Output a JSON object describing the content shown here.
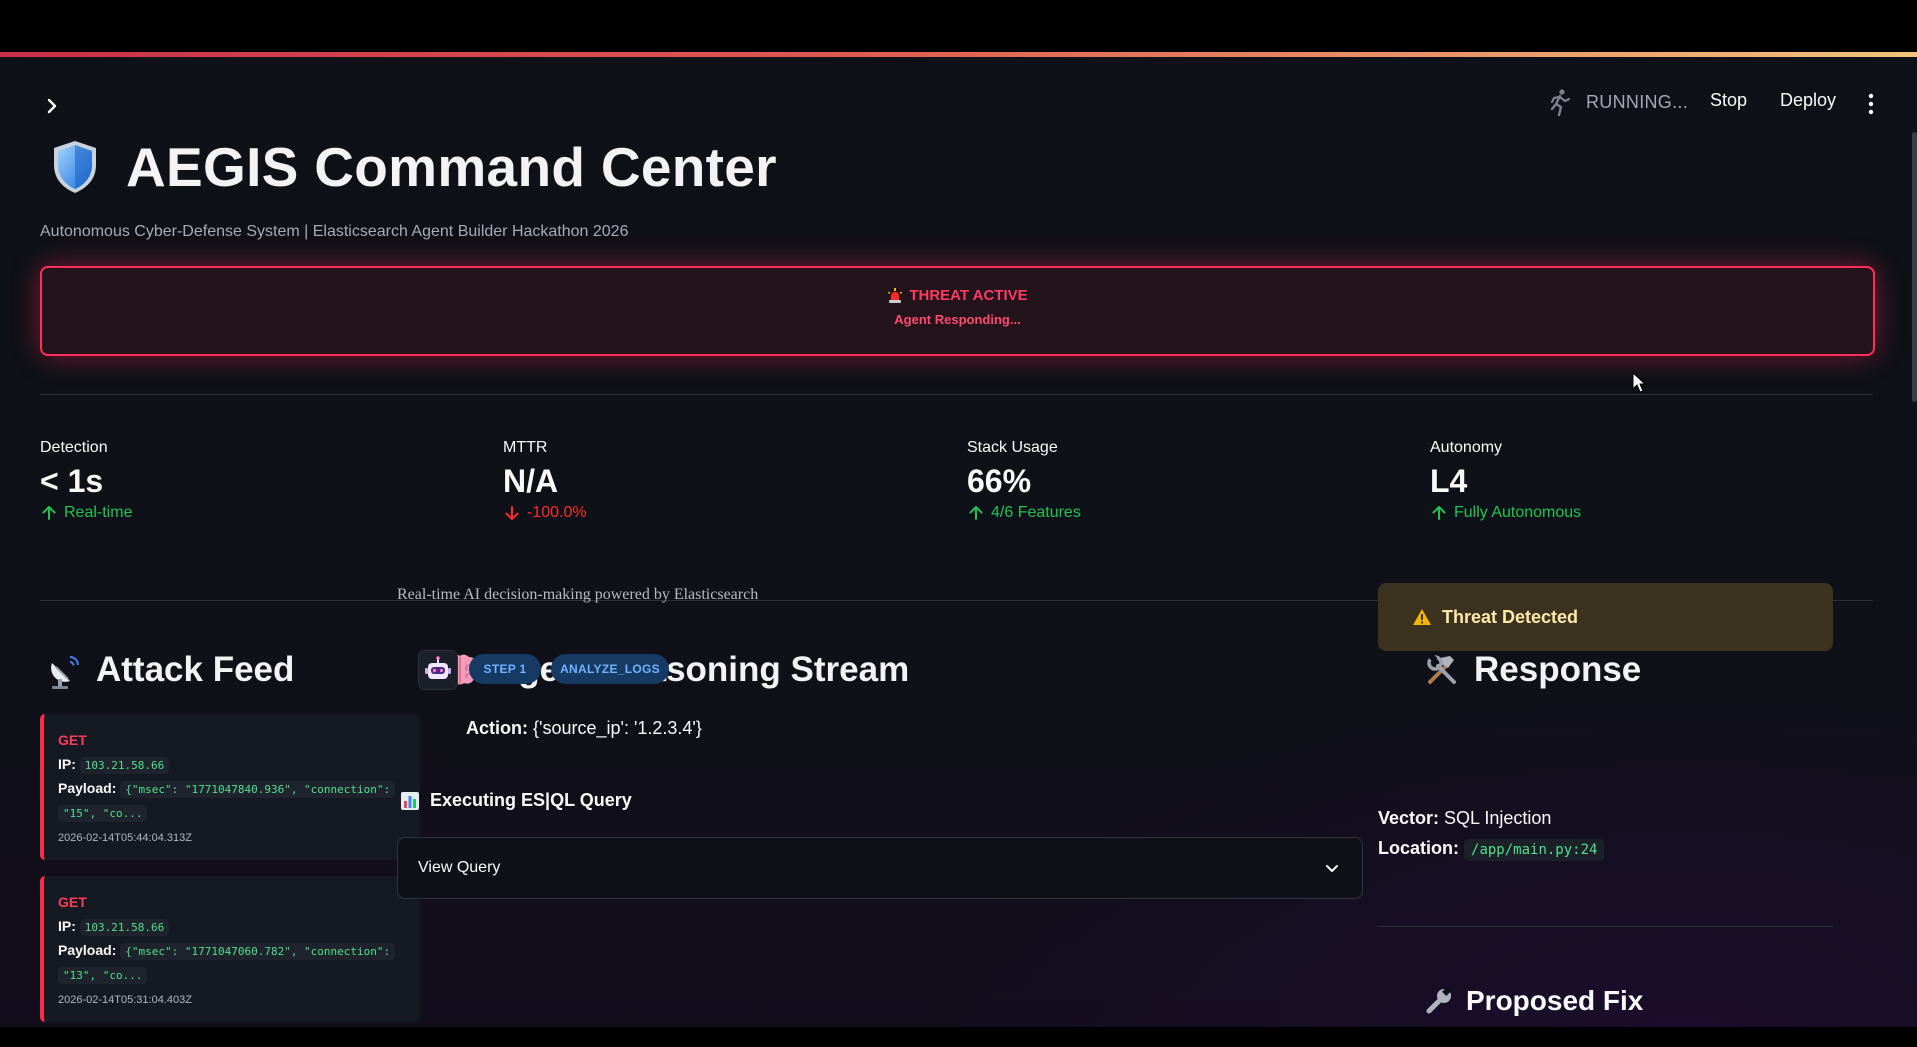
{
  "toolbar": {
    "status": "RUNNING...",
    "stop_label": "Stop",
    "deploy_label": "Deploy"
  },
  "header": {
    "title": "AEGIS Command Center",
    "subtitle": "Autonomous Cyber-Defense System | Elasticsearch Agent Builder Hackathon 2026"
  },
  "alert": {
    "title": "THREAT ACTIVE",
    "subtitle": "Agent Responding..."
  },
  "metrics": [
    {
      "label": "Detection",
      "value": "< 1s",
      "delta": "Real-time",
      "direction": "up"
    },
    {
      "label": "MTTR",
      "value": "N/A",
      "delta": "-100.0%",
      "direction": "down"
    },
    {
      "label": "Stack Usage",
      "value": "66%",
      "delta": "4/6 Features",
      "direction": "up"
    },
    {
      "label": "Autonomy",
      "value": "L4",
      "delta": "Fully Autonomous",
      "direction": "up"
    }
  ],
  "attack_feed": {
    "heading": "Attack Feed",
    "ip_label": "IP:",
    "payload_label": "Payload:",
    "items": [
      {
        "method": "GET",
        "ip": "103.21.58.66",
        "payload_line1": "{\"msec\": \"1771047840.936\", \"connection\":",
        "payload_line2": "\"15\", \"co...",
        "timestamp": "2026-02-14T05:44:04.313Z"
      },
      {
        "method": "GET",
        "ip": "103.21.58.66",
        "payload_line1": "{\"msec\": \"1771047060.782\", \"connection\":",
        "payload_line2": "\"13\", \"co...",
        "timestamp": "2026-02-14T05:31:04.403Z"
      }
    ]
  },
  "reasoning": {
    "heading": "Agent Reasoning Stream",
    "subtitle": "Real-time AI decision-making powered by Elasticsearch",
    "step_pill": "STEP 1",
    "tool_pill": "ANALYZE_LOGS",
    "action_label": "Action:",
    "action_value": "{'source_ip': '1.2.3.4'}",
    "exec_heading": "Executing ES|QL Query",
    "expander_label": "View Query"
  },
  "response": {
    "heading": "Response",
    "alert": "Threat Detected",
    "vector_label": "Vector:",
    "vector_value": "SQL Injection",
    "location_label": "Location:",
    "location_value": "/app/main.py:24",
    "fix_heading": "Proposed Fix"
  },
  "colors": {
    "background": "#0e1117",
    "threat_red": "#ff2f5a",
    "delta_up": "#21c354",
    "delta_down": "#ff2b2b",
    "pill_bg": "#163a64",
    "pill_text": "#6fb3ff",
    "code_green": "#4ee08a",
    "warning_bg": "#3b3320"
  }
}
